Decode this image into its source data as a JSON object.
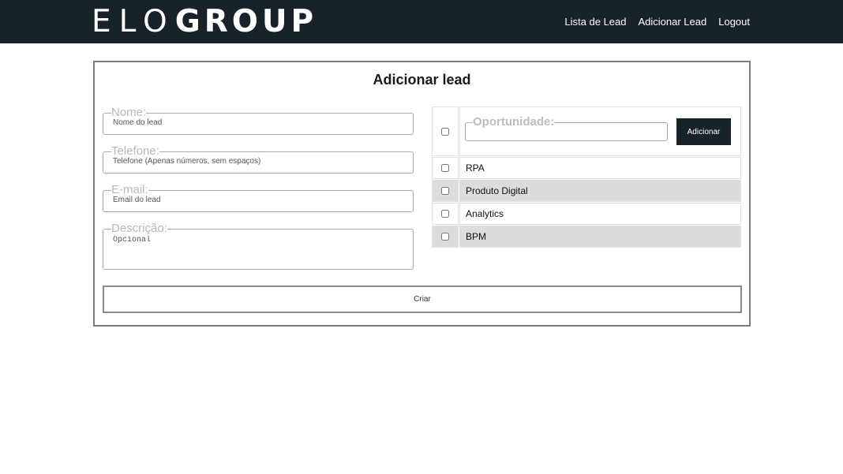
{
  "header": {
    "logo_thin": "ELO",
    "logo_bold": "GROUP",
    "nav": [
      {
        "label": "Lista de Lead"
      },
      {
        "label": "Adicionar Lead"
      },
      {
        "label": "Logout"
      }
    ]
  },
  "form": {
    "title": "Adicionar lead",
    "fields": {
      "nome": {
        "legend": "Nome:",
        "placeholder": "Nome do lead",
        "value": ""
      },
      "telefone": {
        "legend": "Telefone:",
        "placeholder": "Telefone (Apenas números, sem espaços)",
        "value": ""
      },
      "email": {
        "legend": "E-mail:",
        "placeholder": "Email do lead",
        "value": ""
      },
      "descricao": {
        "legend": "Descrição:",
        "placeholder": "Opcional",
        "value": ""
      }
    },
    "opportunity": {
      "legend": "Oportunidade:",
      "input_value": "",
      "add_label": "Adicionar",
      "items": [
        {
          "label": "RPA",
          "checked": false
        },
        {
          "label": "Produto Digital",
          "checked": false
        },
        {
          "label": "Analytics",
          "checked": false
        },
        {
          "label": "BPM",
          "checked": false
        }
      ]
    },
    "submit_label": "Criar"
  },
  "colors": {
    "header_bg": "#172229",
    "row_shaded": "#dcdcdc",
    "legend_text": "#b8b8b8"
  }
}
